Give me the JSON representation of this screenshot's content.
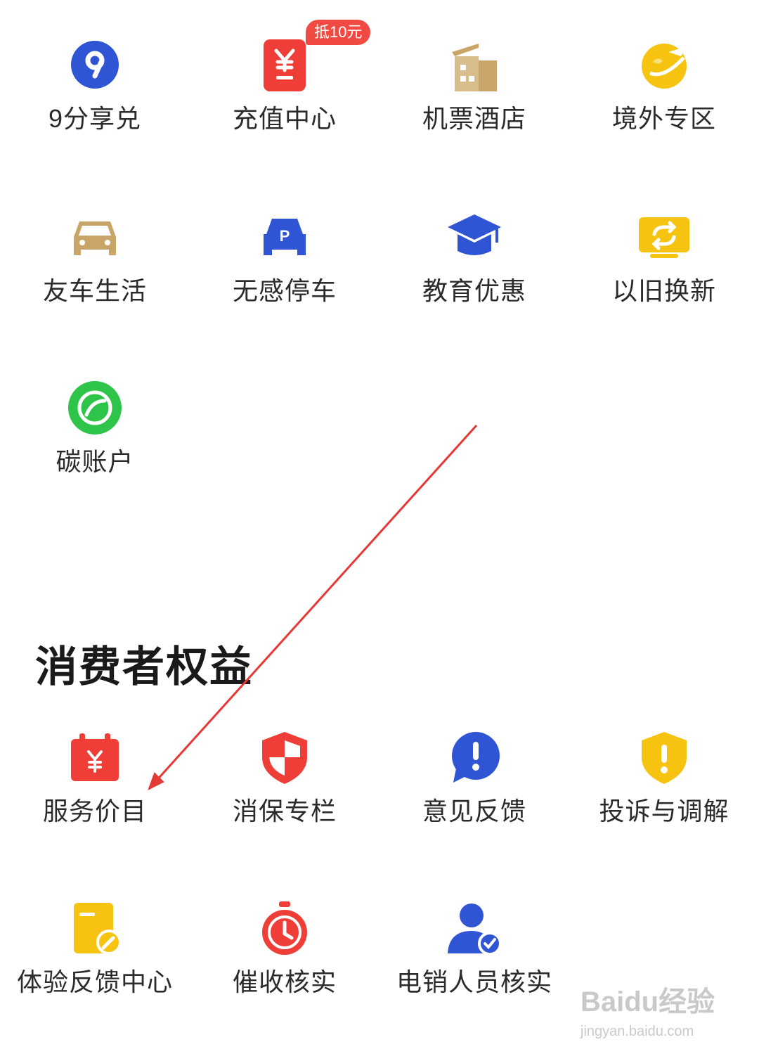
{
  "services_top": [
    {
      "label": "9分享兑",
      "icon": "nine-icon"
    },
    {
      "label": "充值中心",
      "icon": "recharge-card-icon",
      "badge": "抵10元"
    },
    {
      "label": "机票酒店",
      "icon": "hotel-building-icon"
    },
    {
      "label": "境外专区",
      "icon": "globe-plane-icon"
    },
    {
      "label": "友车生活",
      "icon": "car-icon"
    },
    {
      "label": "无感停车",
      "icon": "parking-car-icon"
    },
    {
      "label": "教育优惠",
      "icon": "graduation-cap-icon"
    },
    {
      "label": "以旧换新",
      "icon": "trade-in-icon"
    },
    {
      "label": "碳账户",
      "icon": "leaf-icon"
    }
  ],
  "consumer_rights": {
    "title": "消费者权益",
    "items": [
      {
        "label": "服务价目",
        "icon": "price-calendar-icon"
      },
      {
        "label": "消保专栏",
        "icon": "shield-icon"
      },
      {
        "label": "意见反馈",
        "icon": "feedback-bubble-icon"
      },
      {
        "label": "投诉与调解",
        "icon": "alert-shield-icon"
      },
      {
        "label": "体验反馈中心",
        "icon": "document-edit-icon"
      },
      {
        "label": "催收核实",
        "icon": "stopwatch-icon"
      },
      {
        "label": "电销人员核实",
        "icon": "verified-user-icon"
      }
    ]
  },
  "annotation": {
    "arrow_color": "#e53935"
  },
  "watermark": {
    "logo": "Baidu经验",
    "url": "jingyan.baidu.com"
  },
  "colors": {
    "blue": "#2f54d4",
    "red": "#ee3e37",
    "gold": "#c9a56a",
    "yellow": "#f6c410",
    "green": "#2ec44a"
  }
}
